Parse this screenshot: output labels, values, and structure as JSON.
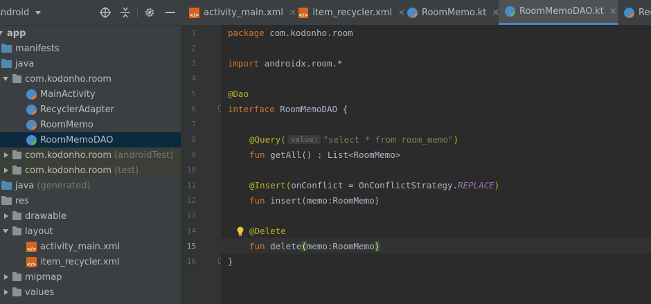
{
  "panel": {
    "view_label": "Android",
    "toolbar": [
      "target-icon",
      "collapse-icon",
      "gear-icon",
      "minimize-icon"
    ],
    "tree": [
      {
        "label": "app",
        "suffix": ""
      },
      {
        "label": "manifests",
        "suffix": ""
      },
      {
        "label": "java",
        "suffix": ""
      },
      {
        "label": "com.kodonho.room",
        "suffix": ""
      },
      {
        "label": "MainActivity",
        "suffix": ""
      },
      {
        "label": "RecyclerAdapter",
        "suffix": ""
      },
      {
        "label": "RoomMemo",
        "suffix": ""
      },
      {
        "label": "RoomMemoDAO",
        "suffix": ""
      },
      {
        "label": "com.kodonho.room",
        "suffix": "(androidTest)"
      },
      {
        "label": "com.kodonho.room",
        "suffix": "(test)"
      },
      {
        "label": "java",
        "suffix": "(generated)"
      },
      {
        "label": "res",
        "suffix": ""
      },
      {
        "label": "drawable",
        "suffix": ""
      },
      {
        "label": "layout",
        "suffix": ""
      },
      {
        "label": "activity_main.xml",
        "suffix": ""
      },
      {
        "label": "item_recycler.xml",
        "suffix": ""
      },
      {
        "label": "mipmap",
        "suffix": ""
      },
      {
        "label": "values",
        "suffix": ""
      }
    ]
  },
  "tabs": [
    {
      "label": "activity_main.xml",
      "close": "×"
    },
    {
      "label": "item_recycler.xml",
      "close": "×"
    },
    {
      "label": "RoomMemo.kt",
      "close": "×"
    },
    {
      "label": "RoomMemoDAO.kt",
      "close": "×"
    },
    {
      "label": "Rec",
      "close": ""
    }
  ],
  "editor": {
    "line_numbers": [
      "1",
      "2",
      "3",
      "4",
      "5",
      "6",
      "7",
      "8",
      "9",
      "10",
      "11",
      "12",
      "13",
      "14",
      "15",
      "16"
    ],
    "current_line": 15,
    "code": {
      "l1_kw": "package",
      "l1_rest": " com.kodonho.room",
      "l3_kw": "import",
      "l3_rest": " androidx.room.*",
      "l5_an": "@Dao",
      "l6_kw": "interface",
      "l6_rest": " RoomMemoDAO {",
      "l8_an": "@Query(",
      "l8_hint": "value:",
      "l8_str": "\"select * from room_memo\"",
      "l8_end": ")",
      "l9_kw": "fun",
      "l9_rest": " getAll() : List<RoomMemo>",
      "l11_an": "@Insert(",
      "l11_a": "onConflict = ",
      "l11_b": "OnConflictStrategy.",
      "l11_it": "REPLACE",
      "l11_end": ")",
      "l12_kw": "fun",
      "l12_rest": " insert(memo:RoomMemo)",
      "l14_an": "@Delete",
      "l15_kw": "fun",
      "l15_a": " delete",
      "l15_p1": "(",
      "l15_b": "memo:RoomMemo",
      "l15_p2": ")",
      "l16": "}"
    }
  },
  "colors": {
    "keyword": "#cc7832",
    "annotation": "#bbb529",
    "string": "#6a8759",
    "constant": "#9876aa",
    "selection": "#0d293e",
    "active_tab_underline": "#4a88c7"
  }
}
